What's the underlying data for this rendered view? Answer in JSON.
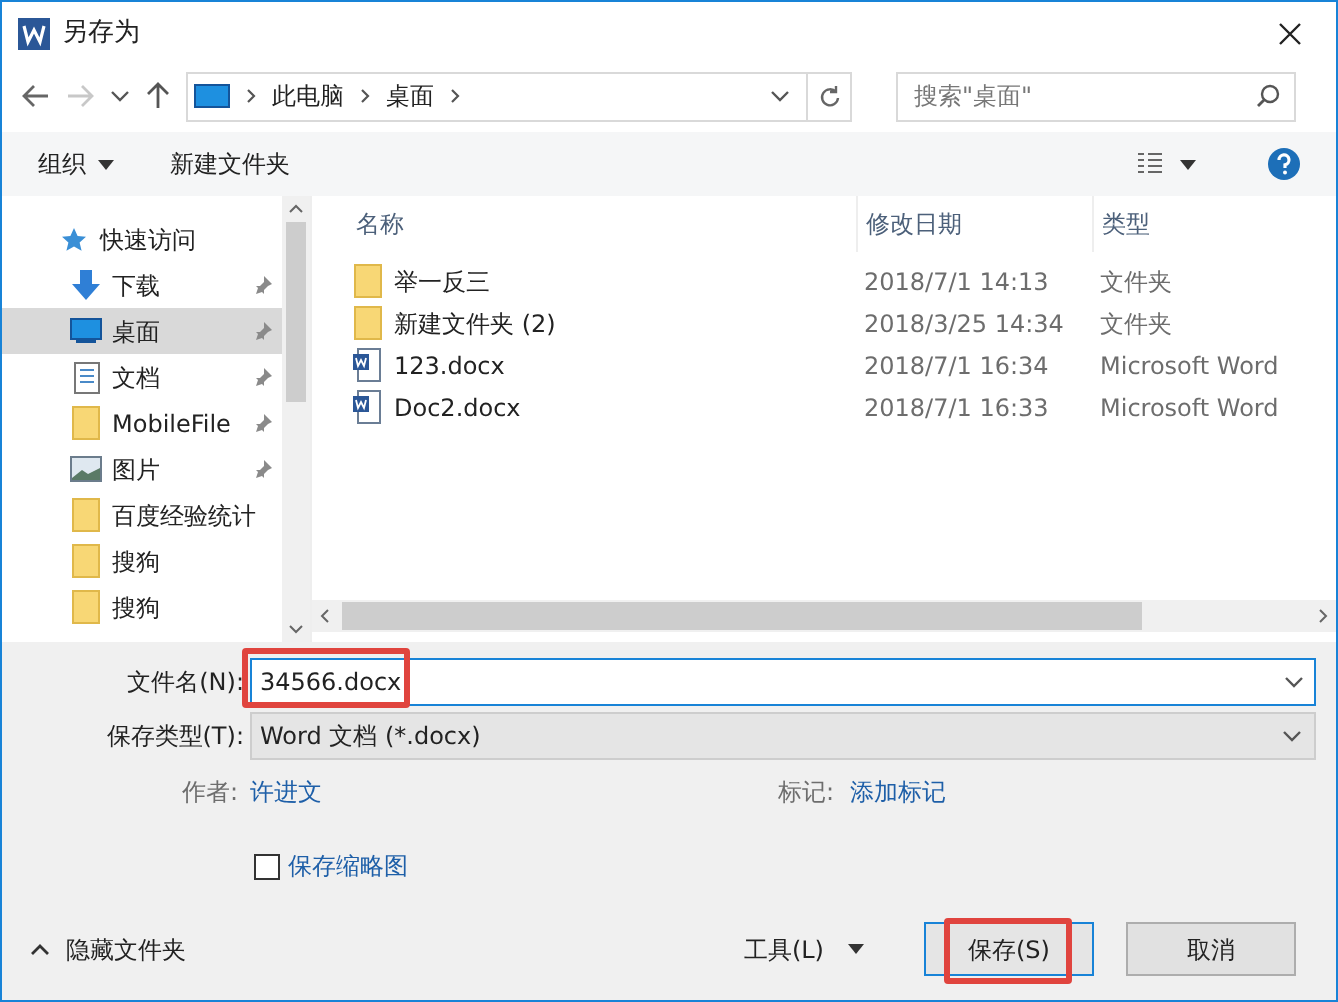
{
  "window": {
    "title": "另存为"
  },
  "address": {
    "crumbs": [
      "此电脑",
      "桌面"
    ],
    "search_placeholder": "搜索\"桌面\""
  },
  "toolbar": {
    "organize": "组织",
    "new_folder": "新建文件夹"
  },
  "sidebar": {
    "items": [
      {
        "label": "快速访问",
        "kind": "star",
        "pinned": false,
        "selected": false
      },
      {
        "label": "下载",
        "kind": "download",
        "pinned": true,
        "selected": false
      },
      {
        "label": "桌面",
        "kind": "desktop",
        "pinned": true,
        "selected": true
      },
      {
        "label": "文档",
        "kind": "document",
        "pinned": true,
        "selected": false
      },
      {
        "label": "MobileFile",
        "kind": "folder",
        "pinned": true,
        "selected": false
      },
      {
        "label": "图片",
        "kind": "picture",
        "pinned": true,
        "selected": false
      },
      {
        "label": "百度经验统计",
        "kind": "folder",
        "pinned": false,
        "selected": false
      },
      {
        "label": "搜狗",
        "kind": "folder",
        "pinned": false,
        "selected": false
      },
      {
        "label": "搜狗",
        "kind": "folder",
        "pinned": false,
        "selected": false
      }
    ]
  },
  "table": {
    "columns": [
      "名称",
      "修改日期",
      "类型"
    ],
    "rows": [
      {
        "kind": "folder",
        "name": "举一反三",
        "date": "2018/7/1 14:13",
        "type": "文件夹"
      },
      {
        "kind": "folder",
        "name": "新建文件夹 (2)",
        "date": "2018/3/25 14:34",
        "type": "文件夹"
      },
      {
        "kind": "word",
        "name": "123.docx",
        "date": "2018/7/1 16:34",
        "type": "Microsoft Word"
      },
      {
        "kind": "word",
        "name": "Doc2.docx",
        "date": "2018/7/1 16:33",
        "type": "Microsoft Word"
      }
    ]
  },
  "form": {
    "filename_label": "文件名(N):",
    "filename": "34566.docx",
    "filename_highlighted": true,
    "type_label": "保存类型(T):",
    "type": "Word 文档 (*.docx)",
    "author_label": "作者:",
    "author": "许进文",
    "tags_label": "标记:",
    "tags": "添加标记",
    "thumbnail": {
      "label": "保存缩略图",
      "checked": false
    }
  },
  "footer": {
    "hide_folders": "隐藏文件夹",
    "tools": "工具(L)",
    "save": "保存(S)",
    "save_highlighted": true,
    "cancel": "取消"
  }
}
